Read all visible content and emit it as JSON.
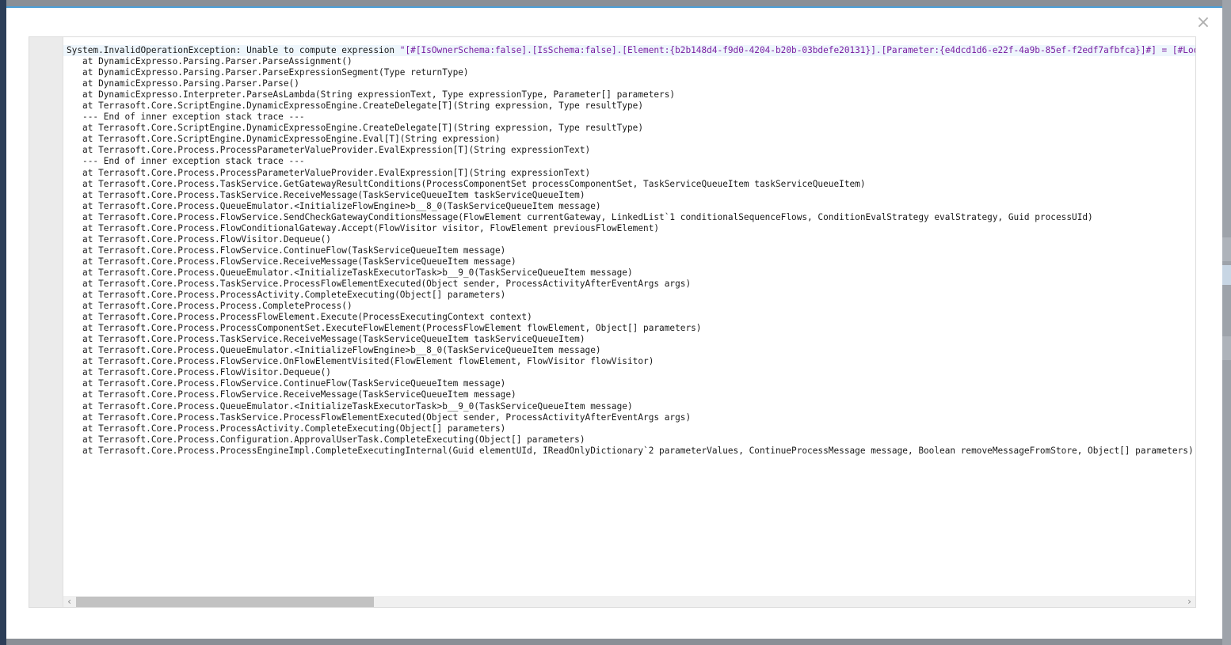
{
  "dialog": {
    "close_glyph": "×"
  },
  "scrollbar": {
    "left_arrow": "‹",
    "right_arrow": "›"
  },
  "stack_trace": {
    "first_line_prefix": "System.InvalidOperationException: Unable to compute expression ",
    "first_line_string": "\"[#[IsOwnerSchema:false].[IsSchema:false].[Element:{b2b148d4-f9d0-4204-b20b-03bdefe20131}].[Parameter:{e4dcd1d6-e22f-4a9b-85ef-f2edf7afbfca}]#] = [#Looku",
    "lines": [
      "   at DynamicExpresso.Parsing.Parser.ParseAssignment()",
      "   at DynamicExpresso.Parsing.Parser.ParseExpressionSegment(Type returnType)",
      "   at DynamicExpresso.Parsing.Parser.Parse()",
      "   at DynamicExpresso.Interpreter.ParseAsLambda(String expressionText, Type expressionType, Parameter[] parameters)",
      "   at Terrasoft.Core.ScriptEngine.DynamicExpressoEngine.CreateDelegate[T](String expression, Type resultType)",
      "   --- End of inner exception stack trace ---",
      "   at Terrasoft.Core.ScriptEngine.DynamicExpressoEngine.CreateDelegate[T](String expression, Type resultType)",
      "   at Terrasoft.Core.ScriptEngine.DynamicExpressoEngine.Eval[T](String expression)",
      "   at Terrasoft.Core.Process.ProcessParameterValueProvider.EvalExpression[T](String expressionText)",
      "   --- End of inner exception stack trace ---",
      "   at Terrasoft.Core.Process.ProcessParameterValueProvider.EvalExpression[T](String expressionText)",
      "   at Terrasoft.Core.Process.TaskService.GetGatewayResultConditions(ProcessComponentSet processComponentSet, TaskServiceQueueItem taskServiceQueueItem)",
      "   at Terrasoft.Core.Process.TaskService.ReceiveMessage(TaskServiceQueueItem taskServiceQueueItem)",
      "   at Terrasoft.Core.Process.QueueEmulator.<InitializeFlowEngine>b__8_0(TaskServiceQueueItem message)",
      "   at Terrasoft.Core.Process.FlowService.SendCheckGatewayConditionsMessage(FlowElement currentGateway, LinkedList`1 conditionalSequenceFlows, ConditionEvalStrategy evalStrategy, Guid processUId)",
      "   at Terrasoft.Core.Process.FlowConditionalGateway.Accept(FlowVisitor visitor, FlowElement previousFlowElement)",
      "   at Terrasoft.Core.Process.FlowVisitor.Dequeue()",
      "   at Terrasoft.Core.Process.FlowService.ContinueFlow(TaskServiceQueueItem message)",
      "   at Terrasoft.Core.Process.FlowService.ReceiveMessage(TaskServiceQueueItem message)",
      "   at Terrasoft.Core.Process.QueueEmulator.<InitializeTaskExecutorTask>b__9_0(TaskServiceQueueItem message)",
      "   at Terrasoft.Core.Process.TaskService.ProcessFlowElementExecuted(Object sender, ProcessActivityAfterEventArgs args)",
      "   at Terrasoft.Core.Process.ProcessActivity.CompleteExecuting(Object[] parameters)",
      "   at Terrasoft.Core.Process.Process.CompleteProcess()",
      "   at Terrasoft.Core.Process.ProcessFlowElement.Execute(ProcessExecutingContext context)",
      "   at Terrasoft.Core.Process.ProcessComponentSet.ExecuteFlowElement(ProcessFlowElement flowElement, Object[] parameters)",
      "   at Terrasoft.Core.Process.TaskService.ReceiveMessage(TaskServiceQueueItem taskServiceQueueItem)",
      "   at Terrasoft.Core.Process.QueueEmulator.<InitializeFlowEngine>b__8_0(TaskServiceQueueItem message)",
      "   at Terrasoft.Core.Process.FlowService.OnFlowElementVisited(FlowElement flowElement, FlowVisitor flowVisitor)",
      "   at Terrasoft.Core.Process.FlowVisitor.Dequeue()",
      "   at Terrasoft.Core.Process.FlowService.ContinueFlow(TaskServiceQueueItem message)",
      "   at Terrasoft.Core.Process.FlowService.ReceiveMessage(TaskServiceQueueItem message)",
      "   at Terrasoft.Core.Process.QueueEmulator.<InitializeTaskExecutorTask>b__9_0(TaskServiceQueueItem message)",
      "   at Terrasoft.Core.Process.TaskService.ProcessFlowElementExecuted(Object sender, ProcessActivityAfterEventArgs args)",
      "   at Terrasoft.Core.Process.ProcessActivity.CompleteExecuting(Object[] parameters)",
      "   at Terrasoft.Core.Process.Configuration.ApprovalUserTask.CompleteExecuting(Object[] parameters)",
      "   at Terrasoft.Core.Process.ProcessEngineImpl.CompleteExecutingInternal(Guid elementUId, IReadOnlyDictionary`2 parameterValues, ContinueProcessMessage message, Boolean removeMessageFromStore, Object[] parameters)"
    ]
  },
  "colors": {
    "accent": "#4b9fd8",
    "string_literal": "#7a1fa2",
    "backdrop_sidebar": "#2c3e58"
  }
}
